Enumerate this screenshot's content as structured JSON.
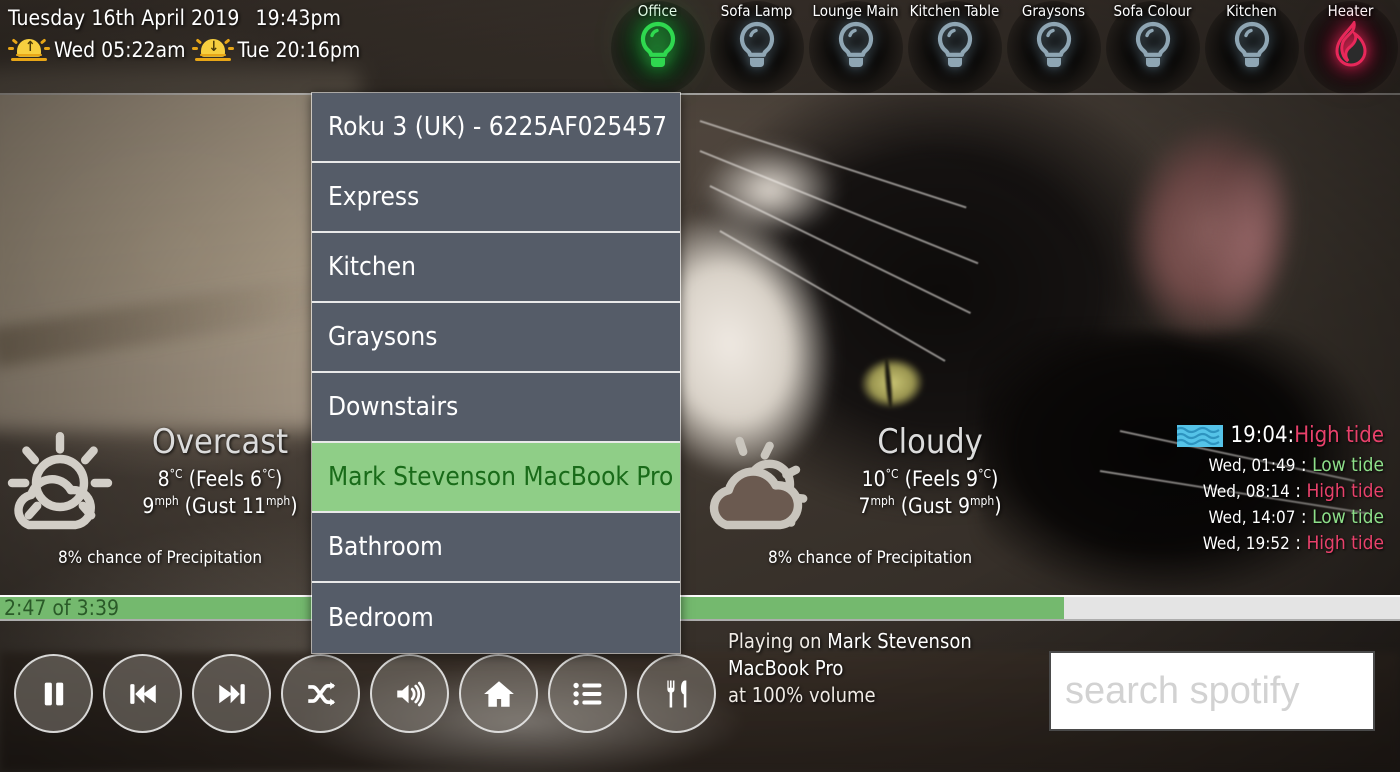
{
  "clock": {
    "date": "Tuesday 16th April 2019",
    "time": "19:43pm",
    "sunrise_label": "Wed 05:22am",
    "sunset_label": "Tue 20:16pm",
    "sunrise_icon": "sunrise-icon",
    "sunset_icon": "sunset-icon"
  },
  "lights": [
    {
      "name": "Office",
      "icon": "lightbulb-icon",
      "state": "on",
      "color": "#2fd84f"
    },
    {
      "name": "Sofa Lamp",
      "icon": "lightbulb-icon",
      "state": "off",
      "color": "#8fa6b4"
    },
    {
      "name": "Lounge Main",
      "icon": "lightbulb-icon",
      "state": "off",
      "color": "#8fa6b4"
    },
    {
      "name": "Kitchen Table",
      "icon": "lightbulb-icon",
      "state": "off",
      "color": "#8fa6b4"
    },
    {
      "name": "Graysons",
      "icon": "lightbulb-icon",
      "state": "off",
      "color": "#8fa6b4"
    },
    {
      "name": "Sofa Colour",
      "icon": "lightbulb-icon",
      "state": "off",
      "color": "#8fa6b4"
    },
    {
      "name": "Kitchen",
      "icon": "lightbulb-icon",
      "state": "off",
      "color": "#8fa6b4"
    },
    {
      "name": "Heater",
      "icon": "flame-icon",
      "state": "off",
      "color": "#e8285a"
    }
  ],
  "weather": [
    {
      "icon": "sun-behind-cloud-icon",
      "condition": "Overcast",
      "temp": "8",
      "temp_unit": "°C",
      "feels_prefix": "(Feels ",
      "feels": "6",
      "feels_unit": "°C",
      "feels_suffix": ")",
      "wind": "9",
      "wind_unit": "mph",
      "gust_prefix": "(Gust ",
      "gust": "11",
      "gust_unit": "mph",
      "gust_suffix": ")",
      "precipitation": "8% chance of Precipitation"
    },
    {
      "icon": "cloud-over-sun-icon",
      "condition": "Cloudy",
      "temp": "10",
      "temp_unit": "°C",
      "feels_prefix": "(Feels ",
      "feels": "9",
      "feels_unit": "°C",
      "feels_suffix": ")",
      "wind": "7",
      "wind_unit": "mph",
      "gust_prefix": "(Gust ",
      "gust": "9",
      "gust_unit": "mph",
      "gust_suffix": ")",
      "precipitation": "8% chance of Precipitation"
    }
  ],
  "tides": {
    "icon": "wave-icon",
    "next": {
      "time": "19:04",
      "sep": " : ",
      "type": "High tide",
      "kind": "high"
    },
    "upcoming": [
      {
        "day": "Wed, ",
        "time": "01:49",
        "sep": " : ",
        "type": "Low tide",
        "kind": "low"
      },
      {
        "day": "Wed, ",
        "time": "08:14",
        "sep": " : ",
        "type": "High tide",
        "kind": "high"
      },
      {
        "day": "Wed, ",
        "time": "14:07",
        "sep": " : ",
        "type": "Low tide",
        "kind": "low"
      },
      {
        "day": "Wed, ",
        "time": "19:52",
        "sep": " : ",
        "type": "High tide",
        "kind": "high"
      }
    ]
  },
  "player": {
    "progress_label": "2:47 of 3:39",
    "elapsed": "2:47",
    "duration": "3:39",
    "progress_percent": 76,
    "fill_color": "#74b96e",
    "now_playing_prefix": "Playing on ",
    "now_playing_device": "Mark Stevenson MacBook Pro",
    "now_playing_volume": "at 100% volume",
    "controls": [
      {
        "name": "pause-button",
        "icon": "pause-icon"
      },
      {
        "name": "previous-button",
        "icon": "previous-track-icon"
      },
      {
        "name": "next-button",
        "icon": "next-track-icon"
      },
      {
        "name": "shuffle-button",
        "icon": "shuffle-icon"
      },
      {
        "name": "volume-button",
        "icon": "volume-icon"
      },
      {
        "name": "home-button",
        "icon": "home-icon"
      },
      {
        "name": "playlist-button",
        "icon": "list-icon"
      },
      {
        "name": "dining-button",
        "icon": "cutlery-icon"
      }
    ]
  },
  "search": {
    "placeholder": "search spotify",
    "value": ""
  },
  "device_menu": {
    "items": [
      {
        "label": "Roku 3 (UK) - 6225AF025457",
        "selected": false
      },
      {
        "label": "Express",
        "selected": false
      },
      {
        "label": "Kitchen",
        "selected": false
      },
      {
        "label": "Graysons",
        "selected": false
      },
      {
        "label": "Downstairs",
        "selected": false
      },
      {
        "label": "Mark Stevenson MacBook Pro",
        "selected": true
      },
      {
        "label": "Bathroom",
        "selected": false
      },
      {
        "label": "Bedroom",
        "selected": false
      }
    ]
  }
}
